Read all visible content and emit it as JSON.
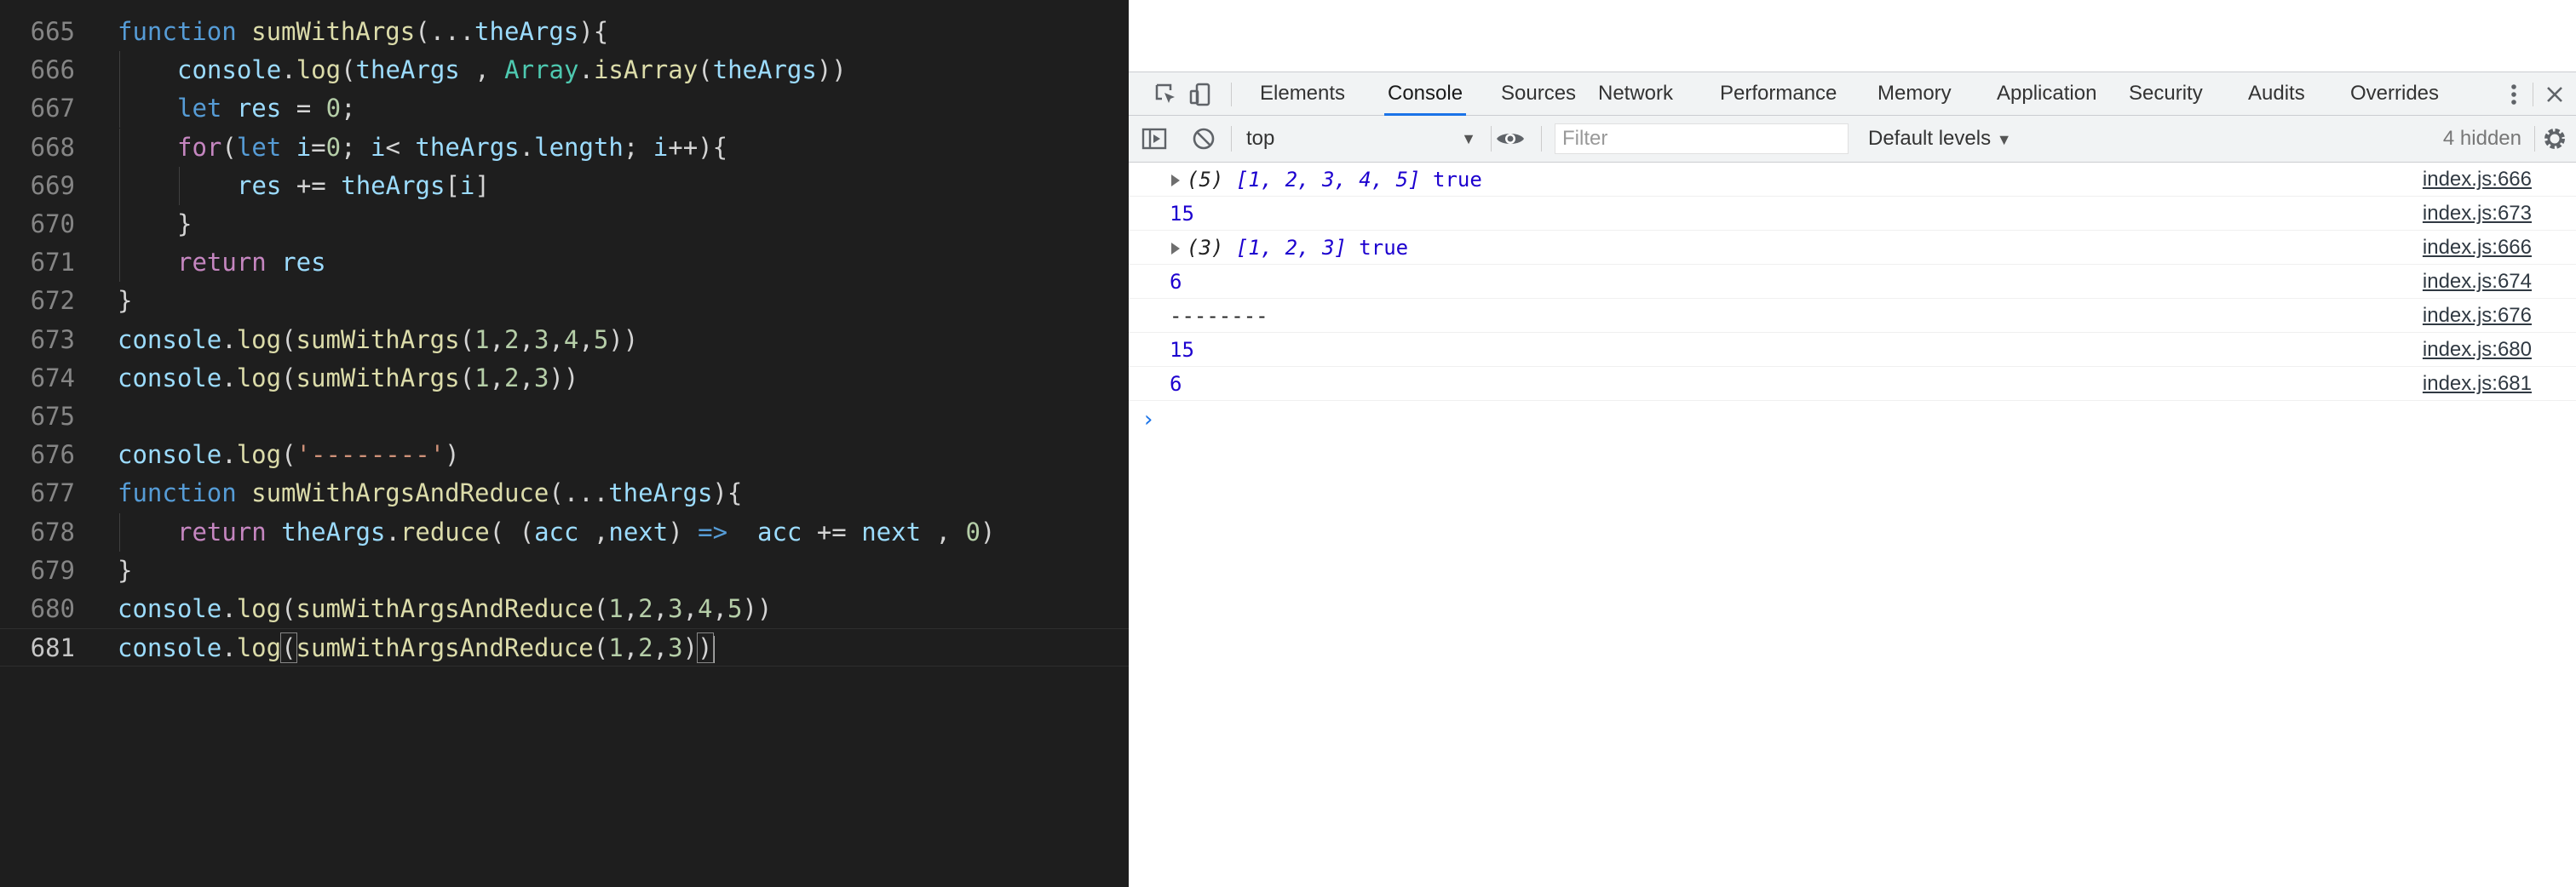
{
  "editor": {
    "lines": [
      {
        "n": "665",
        "tokens": [
          [
            "kw",
            "function "
          ],
          [
            "fn",
            "sumWithArgs"
          ],
          [
            "plain",
            "(..."
          ],
          [
            "var",
            "theArgs"
          ],
          [
            "plain",
            "){"
          ]
        ]
      },
      {
        "n": "666",
        "indent": 1,
        "tokens": [
          [
            "var",
            "console"
          ],
          [
            "plain",
            "."
          ],
          [
            "fn",
            "log"
          ],
          [
            "plain",
            "("
          ],
          [
            "var",
            "theArgs"
          ],
          [
            "plain",
            " , "
          ],
          [
            "typ",
            "Array"
          ],
          [
            "plain",
            "."
          ],
          [
            "fn",
            "isArray"
          ],
          [
            "plain",
            "("
          ],
          [
            "var",
            "theArgs"
          ],
          [
            "plain",
            "))"
          ]
        ]
      },
      {
        "n": "667",
        "indent": 1,
        "tokens": [
          [
            "kw",
            "let "
          ],
          [
            "var",
            "res"
          ],
          [
            "plain",
            " = "
          ],
          [
            "num",
            "0"
          ],
          [
            "plain",
            ";"
          ]
        ]
      },
      {
        "n": "668",
        "indent": 1,
        "tokens": [
          [
            "ctl",
            "for"
          ],
          [
            "plain",
            "("
          ],
          [
            "kw",
            "let "
          ],
          [
            "var",
            "i"
          ],
          [
            "plain",
            "="
          ],
          [
            "num",
            "0"
          ],
          [
            "plain",
            "; "
          ],
          [
            "var",
            "i"
          ],
          [
            "plain",
            "< "
          ],
          [
            "var",
            "theArgs"
          ],
          [
            "plain",
            "."
          ],
          [
            "var",
            "length"
          ],
          [
            "plain",
            "; "
          ],
          [
            "var",
            "i"
          ],
          [
            "plain",
            "++){"
          ]
        ]
      },
      {
        "n": "669",
        "indent": 2,
        "tokens": [
          [
            "var",
            "res"
          ],
          [
            "plain",
            " += "
          ],
          [
            "var",
            "theArgs"
          ],
          [
            "plain",
            "["
          ],
          [
            "var",
            "i"
          ],
          [
            "plain",
            "]"
          ]
        ]
      },
      {
        "n": "670",
        "indent": 1,
        "tokens": [
          [
            "plain",
            "}"
          ]
        ]
      },
      {
        "n": "671",
        "indent": 1,
        "tokens": [
          [
            "ctl",
            "return "
          ],
          [
            "var",
            "res"
          ]
        ]
      },
      {
        "n": "672",
        "tokens": [
          [
            "plain",
            "}"
          ]
        ]
      },
      {
        "n": "673",
        "tokens": [
          [
            "var",
            "console"
          ],
          [
            "plain",
            "."
          ],
          [
            "fn",
            "log"
          ],
          [
            "plain",
            "("
          ],
          [
            "fn",
            "sumWithArgs"
          ],
          [
            "plain",
            "("
          ],
          [
            "num",
            "1"
          ],
          [
            "plain",
            ","
          ],
          [
            "num",
            "2"
          ],
          [
            "plain",
            ","
          ],
          [
            "num",
            "3"
          ],
          [
            "plain",
            ","
          ],
          [
            "num",
            "4"
          ],
          [
            "plain",
            ","
          ],
          [
            "num",
            "5"
          ],
          [
            "plain",
            "))"
          ]
        ]
      },
      {
        "n": "674",
        "tokens": [
          [
            "var",
            "console"
          ],
          [
            "plain",
            "."
          ],
          [
            "fn",
            "log"
          ],
          [
            "plain",
            "("
          ],
          [
            "fn",
            "sumWithArgs"
          ],
          [
            "plain",
            "("
          ],
          [
            "num",
            "1"
          ],
          [
            "plain",
            ","
          ],
          [
            "num",
            "2"
          ],
          [
            "plain",
            ","
          ],
          [
            "num",
            "3"
          ],
          [
            "plain",
            "))"
          ]
        ]
      },
      {
        "n": "675",
        "tokens": []
      },
      {
        "n": "676",
        "tokens": [
          [
            "var",
            "console"
          ],
          [
            "plain",
            "."
          ],
          [
            "fn",
            "log"
          ],
          [
            "plain",
            "("
          ],
          [
            "str",
            "'--------'"
          ],
          [
            "plain",
            ")"
          ]
        ]
      },
      {
        "n": "677",
        "tokens": [
          [
            "kw",
            "function "
          ],
          [
            "fn",
            "sumWithArgsAndReduce"
          ],
          [
            "plain",
            "(..."
          ],
          [
            "var",
            "theArgs"
          ],
          [
            "plain",
            "){"
          ]
        ]
      },
      {
        "n": "678",
        "indent": 1,
        "tokens": [
          [
            "ctl",
            "return "
          ],
          [
            "var",
            "theArgs"
          ],
          [
            "plain",
            "."
          ],
          [
            "fn",
            "reduce"
          ],
          [
            "plain",
            "( ("
          ],
          [
            "var",
            "acc"
          ],
          [
            "plain",
            " ,"
          ],
          [
            "var",
            "next"
          ],
          [
            "plain",
            ") "
          ],
          [
            "kw",
            "=>"
          ],
          [
            "plain",
            "  "
          ],
          [
            "var",
            "acc"
          ],
          [
            "plain",
            " += "
          ],
          [
            "var",
            "next"
          ],
          [
            "plain",
            " , "
          ],
          [
            "num",
            "0"
          ],
          [
            "plain",
            ")"
          ]
        ]
      },
      {
        "n": "679",
        "tokens": [
          [
            "plain",
            "}"
          ]
        ]
      },
      {
        "n": "680",
        "tokens": [
          [
            "var",
            "console"
          ],
          [
            "plain",
            "."
          ],
          [
            "fn",
            "log"
          ],
          [
            "plain",
            "("
          ],
          [
            "fn",
            "sumWithArgsAndReduce"
          ],
          [
            "plain",
            "("
          ],
          [
            "num",
            "1"
          ],
          [
            "plain",
            ","
          ],
          [
            "num",
            "2"
          ],
          [
            "plain",
            ","
          ],
          [
            "num",
            "3"
          ],
          [
            "plain",
            ","
          ],
          [
            "num",
            "4"
          ],
          [
            "plain",
            ","
          ],
          [
            "num",
            "5"
          ],
          [
            "plain",
            "))"
          ]
        ]
      },
      {
        "n": "681",
        "active": true,
        "tokens": [
          [
            "var",
            "console"
          ],
          [
            "plain",
            "."
          ],
          [
            "fn",
            "log"
          ],
          [
            "brk",
            "("
          ],
          [
            "fn",
            "sumWithArgsAndReduce"
          ],
          [
            "plain",
            "("
          ],
          [
            "num",
            "1"
          ],
          [
            "plain",
            ","
          ],
          [
            "num",
            "2"
          ],
          [
            "plain",
            ","
          ],
          [
            "num",
            "3"
          ],
          [
            "plain",
            ")"
          ],
          [
            "brk",
            ")"
          ]
        ]
      }
    ]
  },
  "devtools": {
    "tabs": [
      "Elements",
      "Console",
      "Sources",
      "Network",
      "Performance",
      "Memory",
      "Application",
      "Security",
      "Audits",
      "Overrides"
    ],
    "selected_tab": "Console",
    "context": "top",
    "filter_placeholder": "Filter",
    "levels_label": "Default levels",
    "hidden_label": "4 hidden",
    "messages": [
      {
        "expandable": true,
        "count": "(5)",
        "array": "[1, 2, 3, 4, 5]",
        "extra": " true",
        "source": "index.js:666"
      },
      {
        "value": "15",
        "kind": "num",
        "source": "index.js:673"
      },
      {
        "expandable": true,
        "count": "(3)",
        "array": "[1, 2, 3]",
        "extra": " true",
        "source": "index.js:666"
      },
      {
        "value": "6",
        "kind": "num",
        "source": "index.js:674"
      },
      {
        "value": "--------",
        "kind": "str",
        "source": "index.js:676"
      },
      {
        "value": "15",
        "kind": "num",
        "source": "index.js:680"
      },
      {
        "value": "6",
        "kind": "num",
        "source": "index.js:681"
      }
    ],
    "prompt": "›"
  }
}
